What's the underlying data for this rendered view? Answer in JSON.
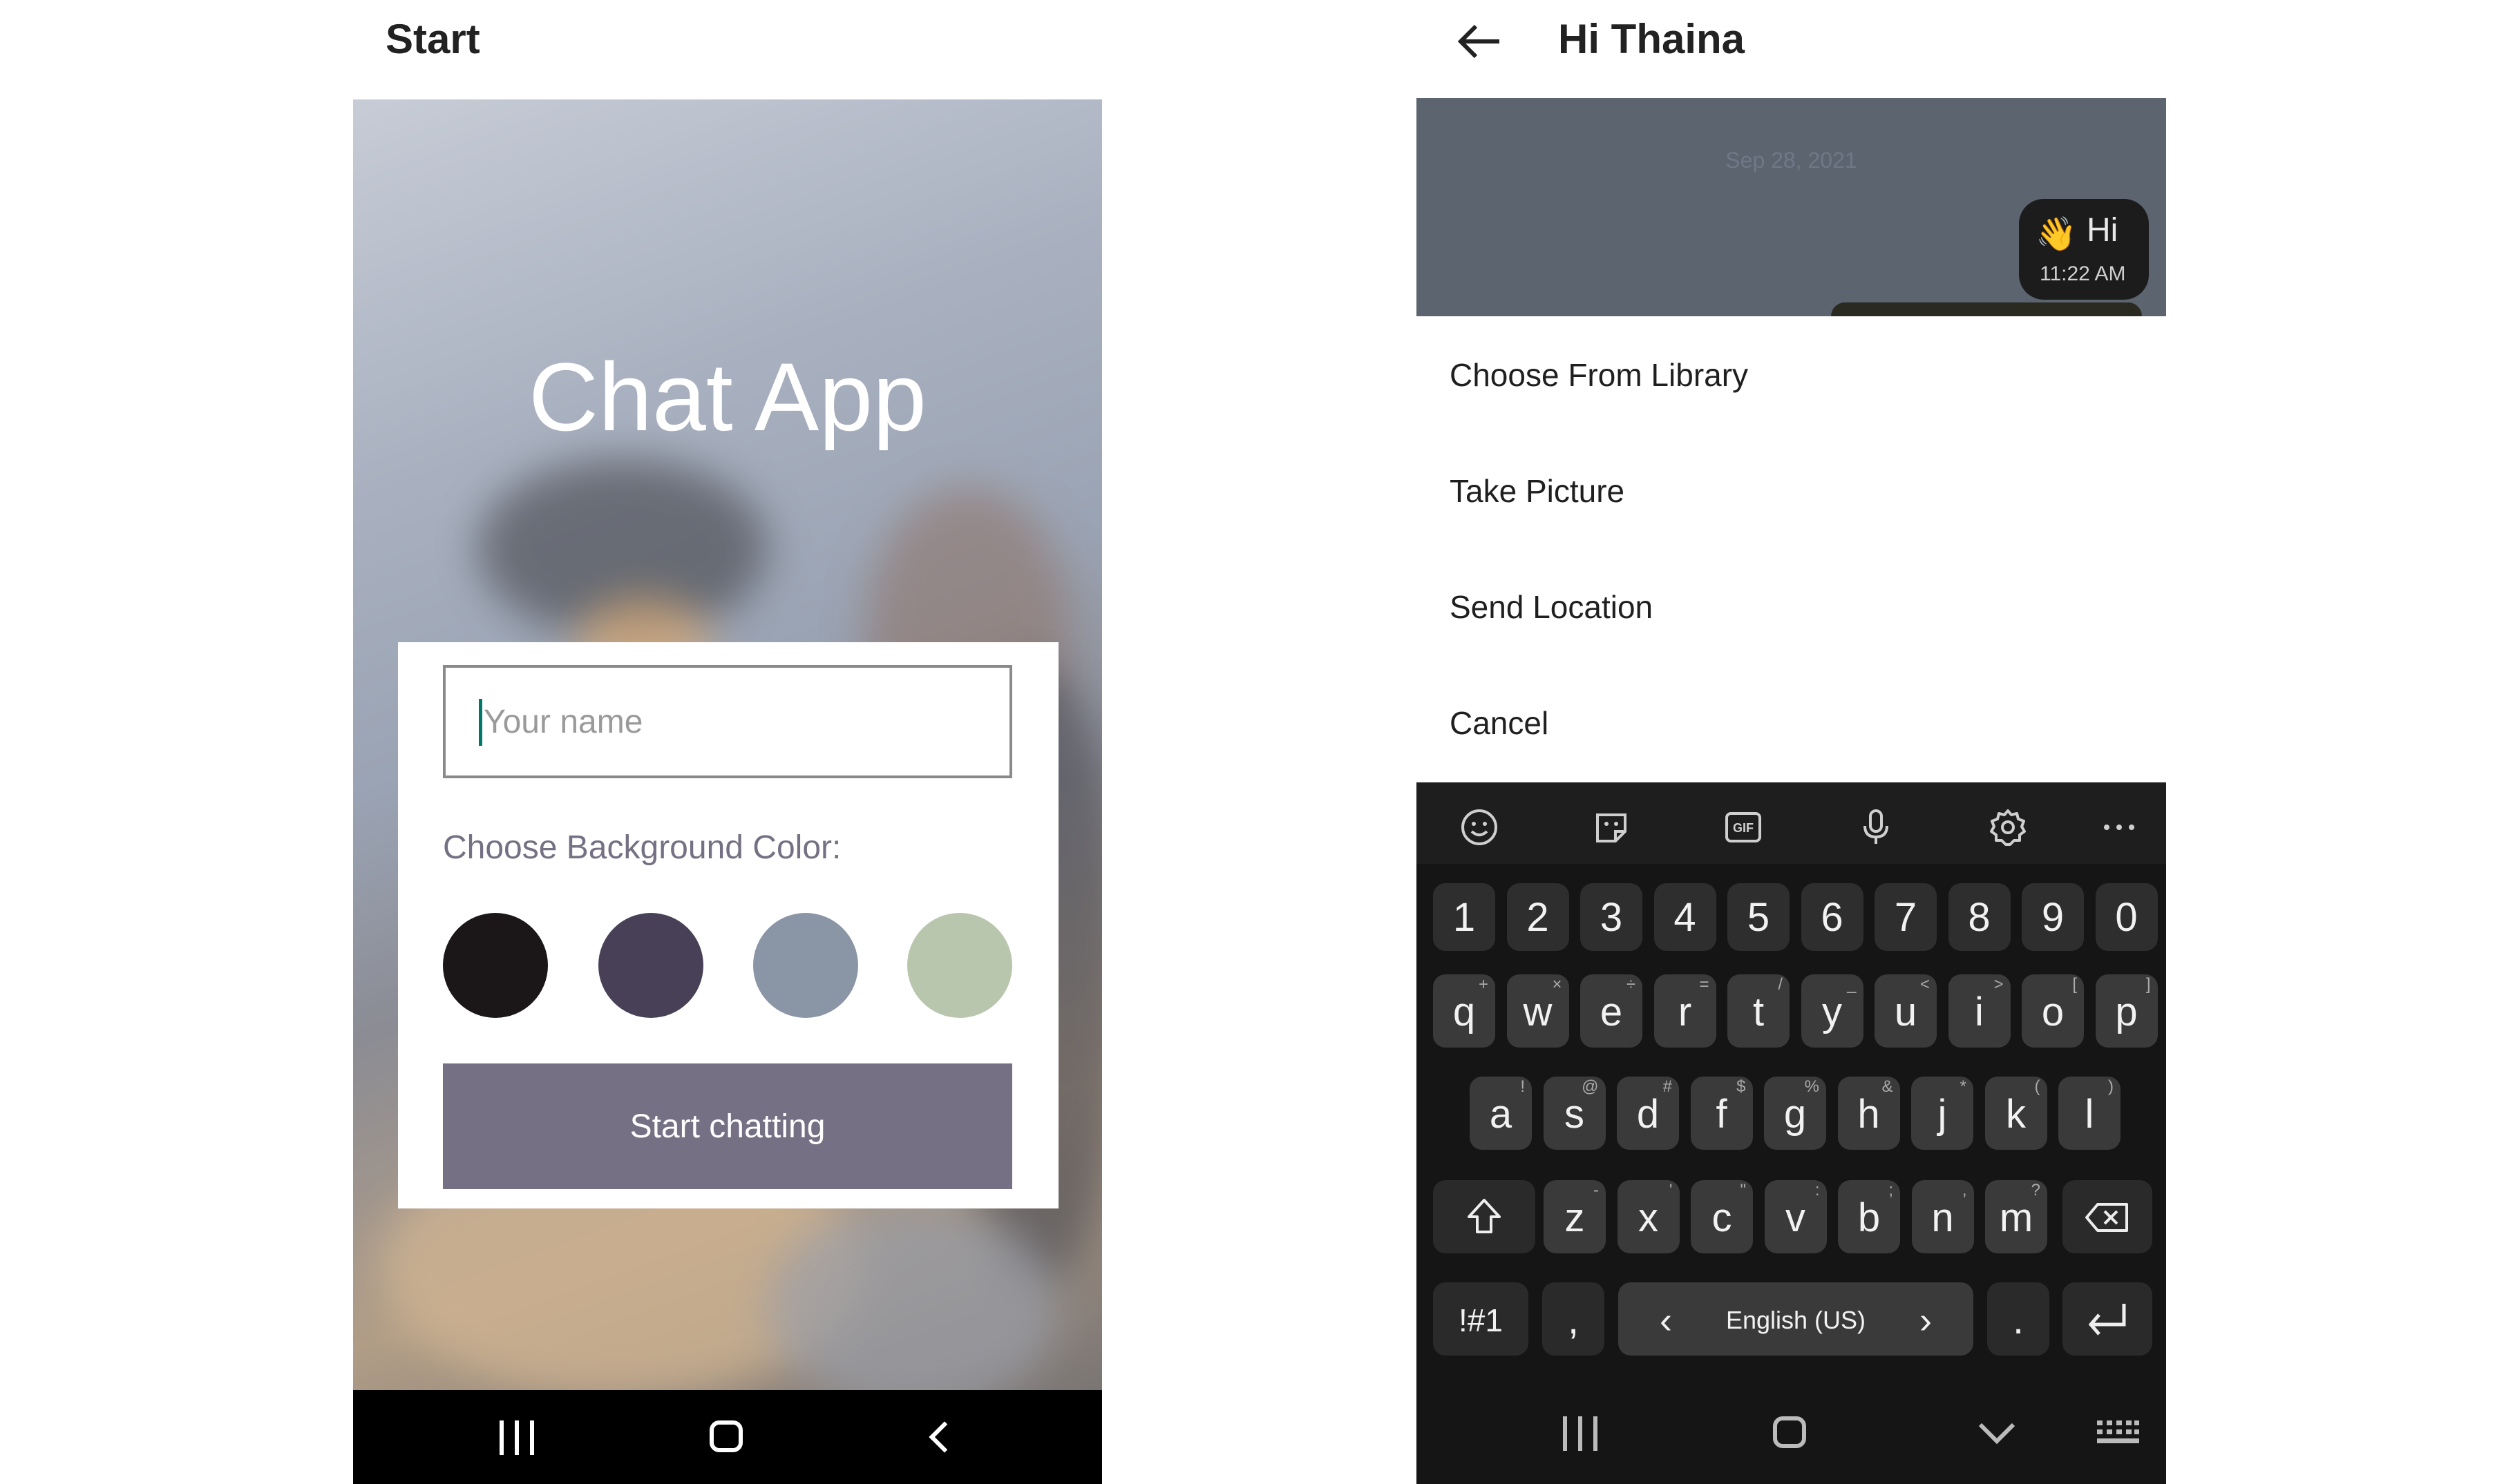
{
  "left_screen": {
    "header_title": "Start",
    "app_title": "Chat App",
    "name_input": {
      "placeholder": "Your name",
      "value": ""
    },
    "background_label": "Choose Background Color:",
    "color_options": [
      "#1b1718",
      "#474056",
      "#8a95a5",
      "#b9c6ae"
    ],
    "start_button_label": "Start chatting"
  },
  "right_screen": {
    "header_title": "Hi Thaina",
    "chat": {
      "date": "Sep 28, 2021",
      "message": {
        "emoji": "👋",
        "text": "Hi",
        "time": "11:22 AM"
      }
    },
    "action_sheet": [
      "Choose From Library",
      "Take Picture",
      "Send Location",
      "Cancel"
    ],
    "keyboard": {
      "toolbar_icons": [
        "emoji-icon",
        "sticker-icon",
        "gif-icon",
        "microphone-icon",
        "settings-icon",
        "more-icon"
      ],
      "gif_label": "GIF",
      "number_row": [
        "1",
        "2",
        "3",
        "4",
        "5",
        "6",
        "7",
        "8",
        "9",
        "0"
      ],
      "row1": [
        "q",
        "w",
        "e",
        "r",
        "t",
        "y",
        "u",
        "i",
        "o",
        "p"
      ],
      "row1_hints": [
        "+",
        "×",
        "÷",
        "=",
        "/",
        "_",
        "<",
        ">",
        "[",
        "]"
      ],
      "row2": [
        "a",
        "s",
        "d",
        "f",
        "g",
        "h",
        "j",
        "k",
        "l"
      ],
      "row2_hints": [
        "!",
        "@",
        "#",
        "$",
        "%",
        "&",
        "*",
        "(",
        ")"
      ],
      "row3": [
        "z",
        "x",
        "c",
        "v",
        "b",
        "n",
        "m"
      ],
      "row3_hints": [
        "-",
        "'",
        "\"",
        ":",
        ";",
        ",",
        "?"
      ],
      "symbols_label": "!#1",
      "comma_label": ",",
      "space_label": "English (US)",
      "period_label": ".",
      "prev_lang": "‹",
      "next_lang": "›"
    }
  }
}
